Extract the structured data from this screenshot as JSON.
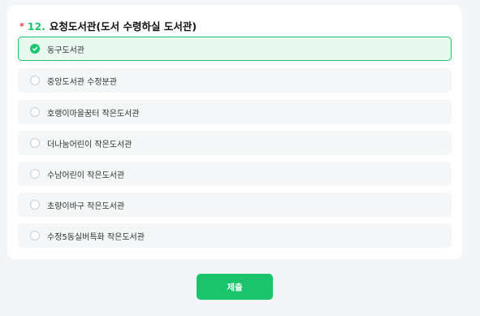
{
  "question": {
    "required_mark": "*",
    "number": "12.",
    "title": "요청도서관(도서 수령하실 도서관)"
  },
  "options": [
    {
      "label": "동구도서관",
      "selected": true
    },
    {
      "label": "중앙도서관 수정분관",
      "selected": false
    },
    {
      "label": "호랭이마을꿈터 작은도서관",
      "selected": false
    },
    {
      "label": "더나눔어린이 작은도서관",
      "selected": false
    },
    {
      "label": "수남어린이 작은도서관",
      "selected": false
    },
    {
      "label": "초량이바구 작은도서관",
      "selected": false
    },
    {
      "label": "수정5동실버특화 작은도서관",
      "selected": false
    }
  ],
  "submit_label": "제출",
  "colors": {
    "accent": "#19c46a",
    "required": "#e03b3b",
    "selected_bg": "#e9f9f0",
    "option_bg": "#f5f6f8",
    "page_bg": "#f4f5f8"
  },
  "icons": {
    "selected": "check-circle-icon",
    "unselected": "radio-circle-icon"
  }
}
